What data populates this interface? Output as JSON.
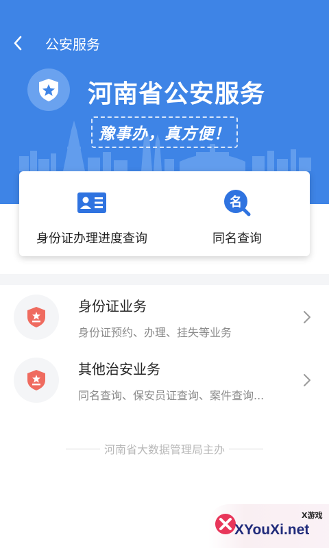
{
  "colors": {
    "primary": "#3e84e6",
    "card_icon_red": "#ef6b5f",
    "text_main": "#222222",
    "text_sub": "#8a8a8a"
  },
  "topbar": {
    "back_icon": "chevron-left-icon",
    "title": "公安服务"
  },
  "hero": {
    "badge_icon": "police-shield-star-icon",
    "title": "河南省公安服务",
    "slogan": "豫事办，真方便！"
  },
  "quick_actions": [
    {
      "icon": "id-card-icon",
      "label": "身份证办理进度查询"
    },
    {
      "icon": "name-search-icon",
      "icon_text": "名",
      "label": "同名查询"
    }
  ],
  "services": [
    {
      "icon": "police-badge-icon",
      "title": "身份证业务",
      "desc": "身份证预约、办理、挂失等业务"
    },
    {
      "icon": "police-badge-icon",
      "title": "其他治安业务",
      "desc": "同名查询、保安员证查询、案件查询..."
    }
  ],
  "footer": {
    "text": "河南省大数据管理局主办"
  },
  "watermark": {
    "small": "X游戏",
    "site": "XYouXi.net"
  }
}
